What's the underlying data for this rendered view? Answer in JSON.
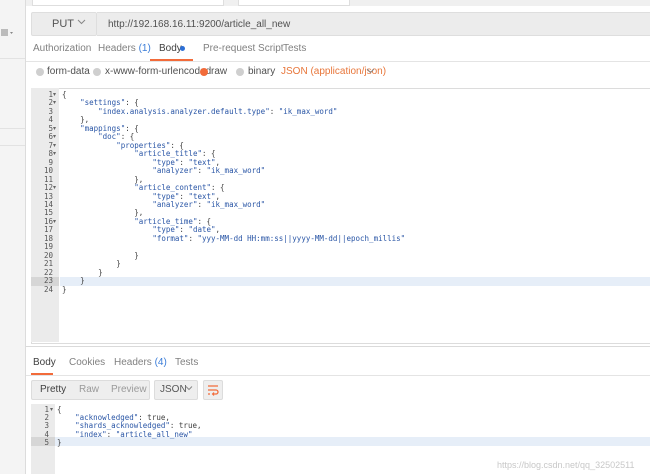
{
  "request": {
    "method": "PUT",
    "url": "http://192.168.16.11:9200/article_all_new",
    "tabs": [
      {
        "label": "Authorization",
        "count": ""
      },
      {
        "label": "Headers",
        "count": "(1)"
      },
      {
        "label": "Body",
        "count": ""
      },
      {
        "label": "Pre-request Script",
        "count": ""
      },
      {
        "label": "Tests",
        "count": ""
      }
    ],
    "body_options": [
      "form-data",
      "x-www-form-urlencoded",
      "raw",
      "binary"
    ],
    "selected_option": "raw",
    "content_type": "JSON (application/json)",
    "active_tab_color": "#f26b3a",
    "dot_color": "#2d6fd6"
  },
  "editor": {
    "lines": [
      "{",
      "    \"settings\": {",
      "        \"index.analysis.analyzer.default.type\": \"ik_max_word\"",
      "    },",
      "    \"mappings\": {",
      "        \"doc\": {",
      "            \"properties\": {",
      "                \"article_title\": {",
      "                    \"type\": \"text\",",
      "                    \"analyzer\": \"ik_max_word\"",
      "                },",
      "                \"article_content\": {",
      "                    \"type\": \"text\",",
      "                    \"analyzer\": \"ik_max_word\"",
      "                },",
      "                \"article_time\": {",
      "                    \"type\": \"date\",",
      "                    \"format\": \"yyy-MM-dd HH:mm:ss||yyyy-MM-dd||epoch_millis\"",
      "                    ",
      "                }",
      "            }",
      "        }",
      "    }",
      "}"
    ],
    "fold_lines": [
      1,
      2,
      5,
      6,
      7,
      8,
      12,
      16
    ],
    "active_line": 23
  },
  "response": {
    "tabs": [
      {
        "label": "Body",
        "count": ""
      },
      {
        "label": "Cookies",
        "count": ""
      },
      {
        "label": "Headers",
        "count": "(4)"
      },
      {
        "label": "Tests",
        "count": ""
      }
    ],
    "formats": [
      "Pretty",
      "Raw",
      "Preview"
    ],
    "format_type": "JSON",
    "lines": [
      "{",
      "    \"acknowledged\": true,",
      "    \"shards_acknowledged\": true,",
      "    \"index\": \"article_all_new\"",
      "}"
    ],
    "active_line": 5
  },
  "watermark": "https://blog.csdn.net/qq_32502511"
}
